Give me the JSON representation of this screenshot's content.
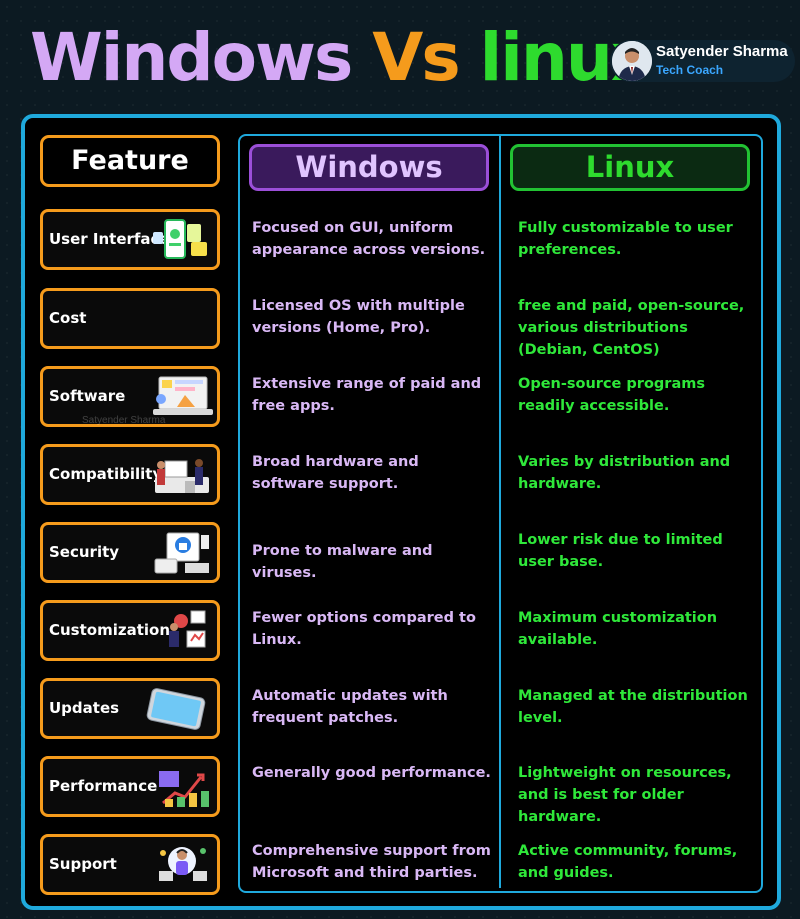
{
  "title": {
    "part1": "Windows",
    "part2": "Vs",
    "part3": "linux"
  },
  "author": {
    "name": "Satyender Sharma",
    "role": "Tech Coach"
  },
  "watermark": "Satyender Sharma",
  "headers": {
    "feature": "Feature",
    "windows": "Windows",
    "linux": "Linux"
  },
  "colors": {
    "windows": "#d4a8f5",
    "vs": "#f59b1c",
    "linux": "#2edb2e",
    "frame": "#1fa9dc",
    "feature_border": "#f59b1c"
  },
  "rows": [
    {
      "feature": "User Interface",
      "icon": "mobile-ui-icon",
      "windows": "Focused on GUI, uniform appearance across versions.",
      "linux": "Fully customizable to user preferences."
    },
    {
      "feature": "Cost",
      "icon": "",
      "windows": "Licensed OS with multiple versions (Home, Pro).",
      "linux": " free and paid, open-source, various distributions (Debian, CentOS)"
    },
    {
      "feature": "Software",
      "icon": "laptop-software-icon",
      "windows": "Extensive range of paid and free apps.",
      "linux": "Open-source programs readily accessible."
    },
    {
      "feature": "Compatibility",
      "icon": "people-devices-icon",
      "windows": "Broad hardware and software support.",
      "linux": "Varies by distribution and hardware."
    },
    {
      "feature": "Security",
      "icon": "lock-shield-icon",
      "windows": "Prone to malware and viruses.",
      "linux": "Lower risk due to limited user base."
    },
    {
      "feature": "Customization",
      "icon": "settings-people-icon",
      "windows": "Fewer options compared to Linux.",
      "linux": "Maximum customization available."
    },
    {
      "feature": "Updates",
      "icon": "tablet-icon",
      "windows": "Automatic updates with frequent patches.",
      "linux": "Managed at the distribution level."
    },
    {
      "feature": "Performance",
      "icon": "growth-chart-icon",
      "windows": "Generally good performance.",
      "linux": "Lightweight on resources, and is best for older hardware."
    },
    {
      "feature": "Support",
      "icon": "support-person-icon",
      "windows": "Comprehensive support from Microsoft and third parties.",
      "linux": "Active community, forums, and guides."
    }
  ]
}
